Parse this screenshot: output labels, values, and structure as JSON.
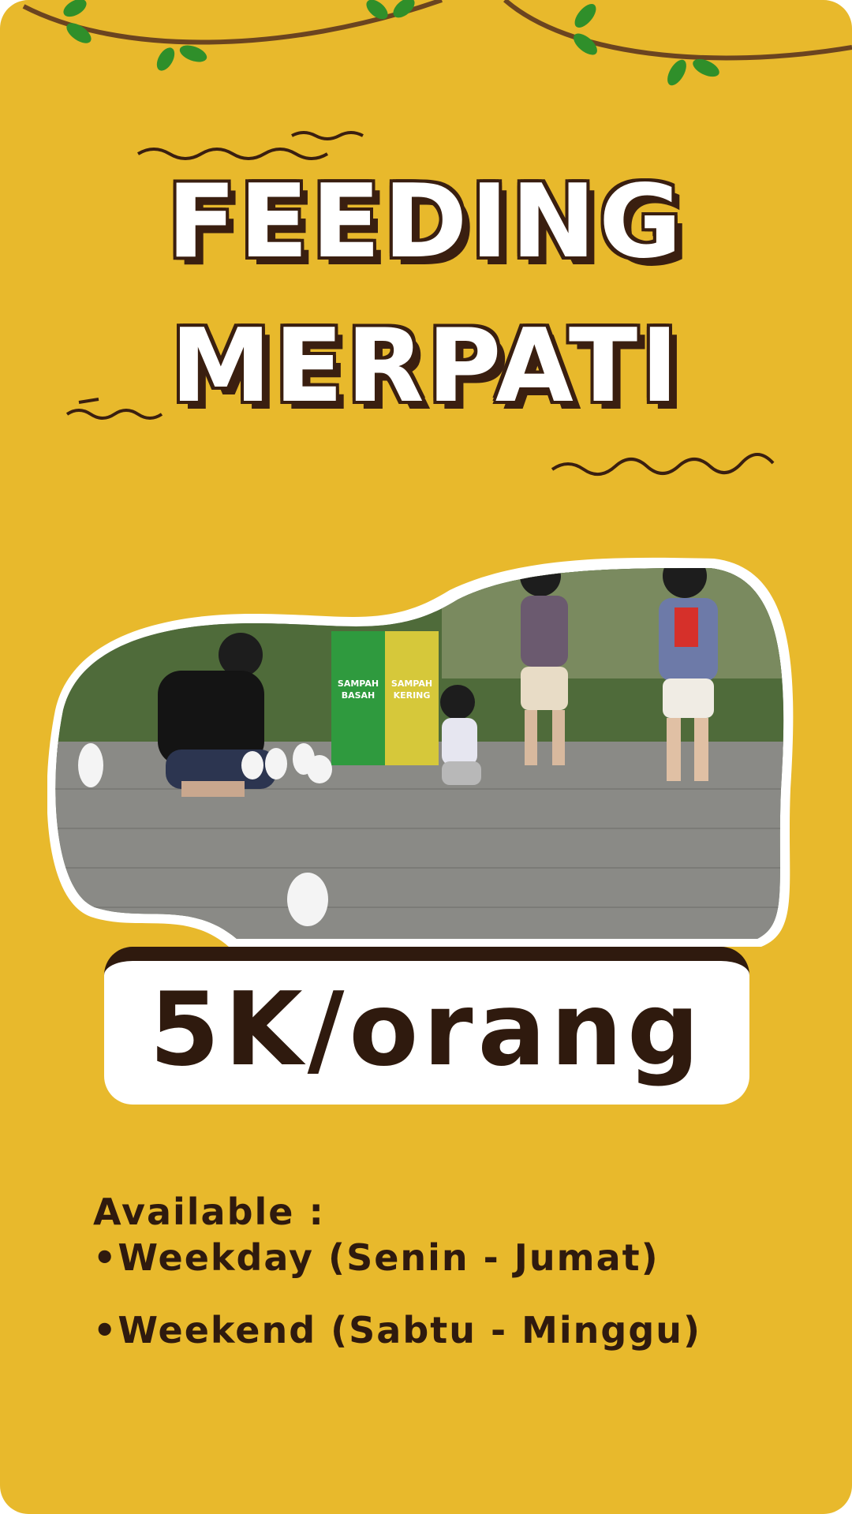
{
  "colors": {
    "background": "#e8b92c",
    "dark_brown": "#2f1a0e",
    "white": "#ffffff",
    "leaf_green": "#2f8f2a"
  },
  "title": {
    "line1": "FEEDING",
    "line2": "MERPATI"
  },
  "photo": {
    "sign_left": "SAMPAH BASAH",
    "sign_right": "SAMPAH KERING"
  },
  "price": {
    "label": "5K/orang"
  },
  "availability": {
    "heading": "Available :",
    "items": [
      "Weekday (Senin - Jumat)",
      "Weekend (Sabtu - Minggu)"
    ]
  }
}
